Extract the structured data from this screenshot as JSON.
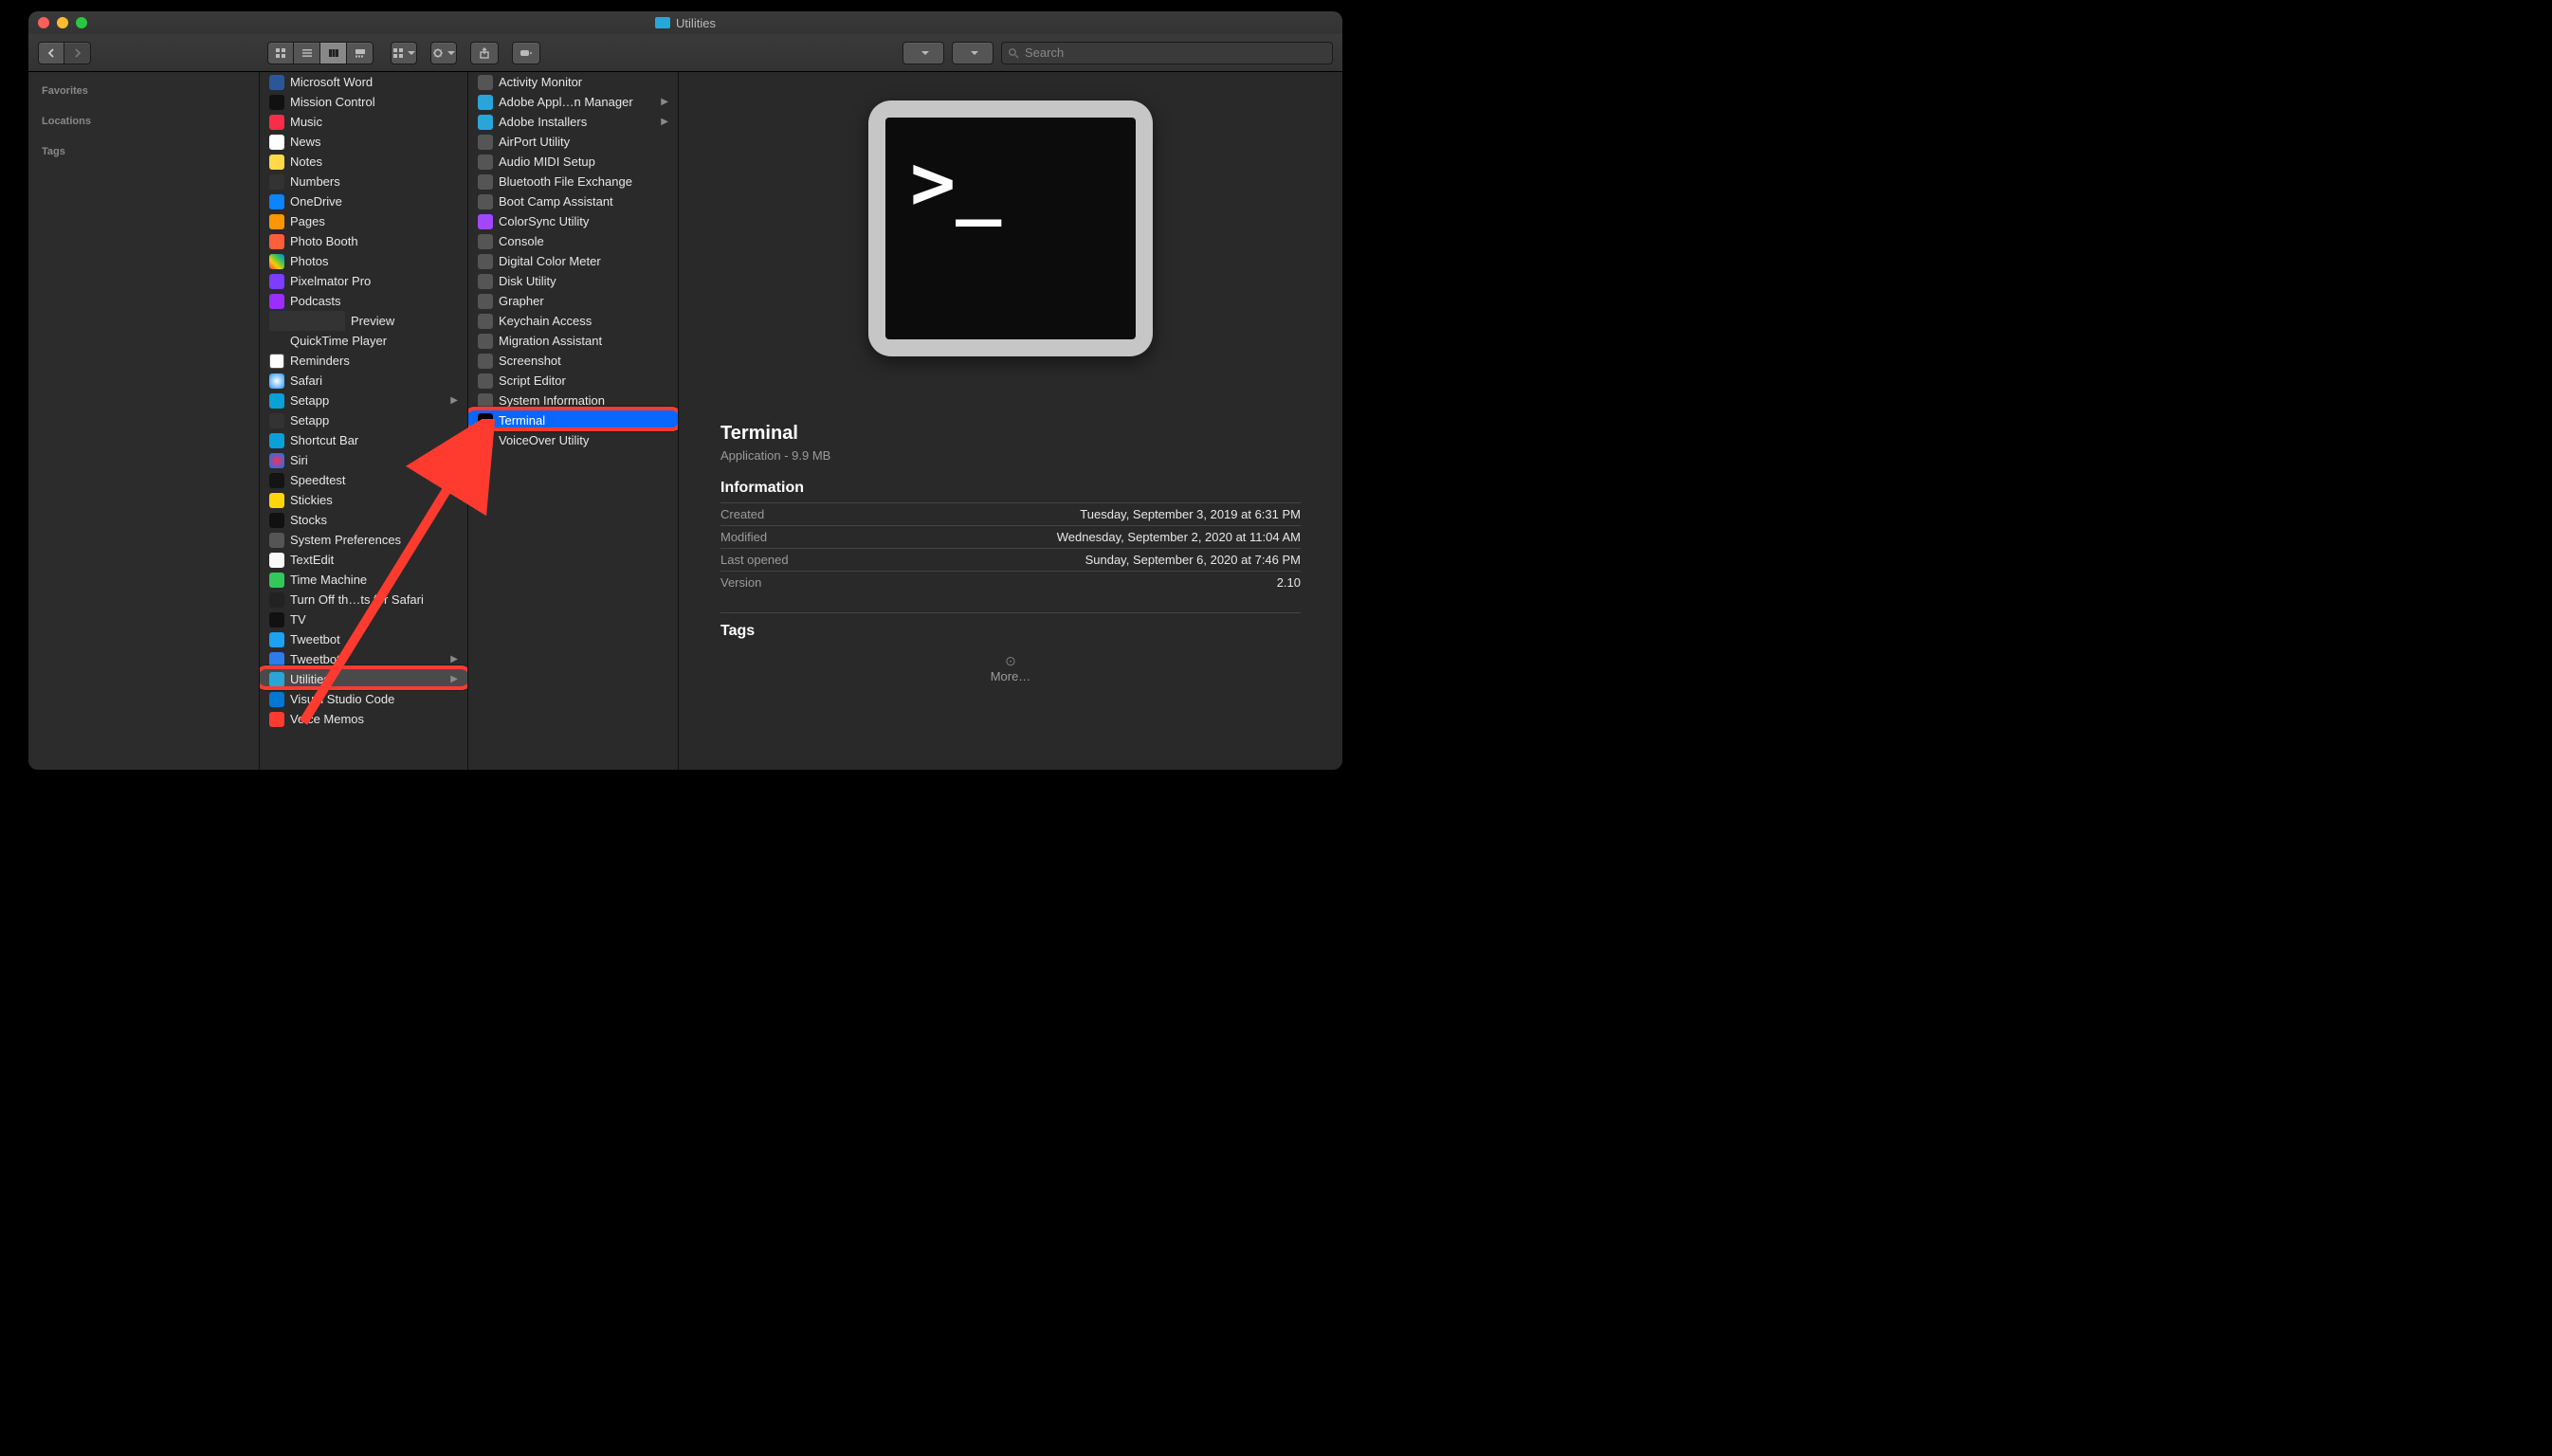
{
  "window": {
    "title": "Utilities"
  },
  "toolbar": {
    "search_placeholder": "Search"
  },
  "sidebar": {
    "headers": {
      "favorites": "Favorites",
      "locations": "Locations",
      "tags": "Tags"
    }
  },
  "col1": {
    "items": [
      {
        "label": "Microsoft Word",
        "icon": "word"
      },
      {
        "label": "Mission Control",
        "icon": "mission"
      },
      {
        "label": "Music",
        "icon": "music"
      },
      {
        "label": "News",
        "icon": "news"
      },
      {
        "label": "Notes",
        "icon": "notes"
      },
      {
        "label": "Numbers",
        "icon": "numbers"
      },
      {
        "label": "OneDrive",
        "icon": "onedrive"
      },
      {
        "label": "Pages",
        "icon": "pages"
      },
      {
        "label": "Photo Booth",
        "icon": "photobooth"
      },
      {
        "label": "Photos",
        "icon": "photos"
      },
      {
        "label": "Pixelmator Pro",
        "icon": "pixel"
      },
      {
        "label": "Podcasts",
        "icon": "pod"
      },
      {
        "label": "Preview",
        "icon": "preview"
      },
      {
        "label": "QuickTime Player",
        "icon": "qt"
      },
      {
        "label": "Reminders",
        "icon": "rem"
      },
      {
        "label": "Safari",
        "icon": "safari"
      },
      {
        "label": "Setapp",
        "icon": "setapp",
        "hasChildren": true
      },
      {
        "label": "Setapp",
        "icon": "setapp2"
      },
      {
        "label": "Shortcut Bar",
        "icon": "shortcut"
      },
      {
        "label": "Siri",
        "icon": "siri"
      },
      {
        "label": "Speedtest",
        "icon": "speed"
      },
      {
        "label": "Stickies",
        "icon": "stickies"
      },
      {
        "label": "Stocks",
        "icon": "stocks"
      },
      {
        "label": "System Preferences",
        "icon": "sysp"
      },
      {
        "label": "TextEdit",
        "icon": "textedit"
      },
      {
        "label": "Time Machine",
        "icon": "time"
      },
      {
        "label": "Turn Off th…ts for Safari",
        "icon": "turn"
      },
      {
        "label": "TV",
        "icon": "tv"
      },
      {
        "label": "Tweetbot",
        "icon": "tweet"
      },
      {
        "label": "Tweetbot",
        "icon": "tweetf",
        "hasChildren": true
      },
      {
        "label": "Utilities",
        "icon": "util",
        "hasChildren": true,
        "selected": true,
        "ring": true
      },
      {
        "label": "Visual Studio Code",
        "icon": "vscode"
      },
      {
        "label": "Voice Memos",
        "icon": "voice"
      }
    ]
  },
  "col2": {
    "items": [
      {
        "label": "Activity Monitor",
        "icon": "gray"
      },
      {
        "label": "Adobe Appl…n Manager",
        "icon": "folder",
        "hasChildren": true
      },
      {
        "label": "Adobe Installers",
        "icon": "folder",
        "hasChildren": true
      },
      {
        "label": "AirPort Utility",
        "icon": "gray"
      },
      {
        "label": "Audio MIDI Setup",
        "icon": "gray"
      },
      {
        "label": "Bluetooth File Exchange",
        "icon": "gray"
      },
      {
        "label": "Boot Camp Assistant",
        "icon": "gray"
      },
      {
        "label": "ColorSync Utility",
        "icon": "col"
      },
      {
        "label": "Console",
        "icon": "gray"
      },
      {
        "label": "Digital Color Meter",
        "icon": "gray"
      },
      {
        "label": "Disk Utility",
        "icon": "gray"
      },
      {
        "label": "Grapher",
        "icon": "gray"
      },
      {
        "label": "Keychain Access",
        "icon": "gray"
      },
      {
        "label": "Migration Assistant",
        "icon": "gray"
      },
      {
        "label": "Screenshot",
        "icon": "gray"
      },
      {
        "label": "Script Editor",
        "icon": "gray"
      },
      {
        "label": "System Information",
        "icon": "gray"
      },
      {
        "label": "Terminal",
        "icon": "term",
        "selectedBlue": true,
        "ring": true
      },
      {
        "label": "VoiceOver Utility",
        "icon": "gray"
      }
    ]
  },
  "preview": {
    "name": "Terminal",
    "subtitle": "Application - 9.9 MB",
    "info_header": "Information",
    "rows": [
      {
        "k": "Created",
        "v": "Tuesday, September 3, 2019 at 6:31 PM"
      },
      {
        "k": "Modified",
        "v": "Wednesday, September 2, 2020 at 11:04 AM"
      },
      {
        "k": "Last opened",
        "v": "Sunday, September 6, 2020 at 7:46 PM"
      },
      {
        "k": "Version",
        "v": "2.10"
      }
    ],
    "tags_header": "Tags",
    "more": "More…"
  },
  "term_prompt": ">_"
}
